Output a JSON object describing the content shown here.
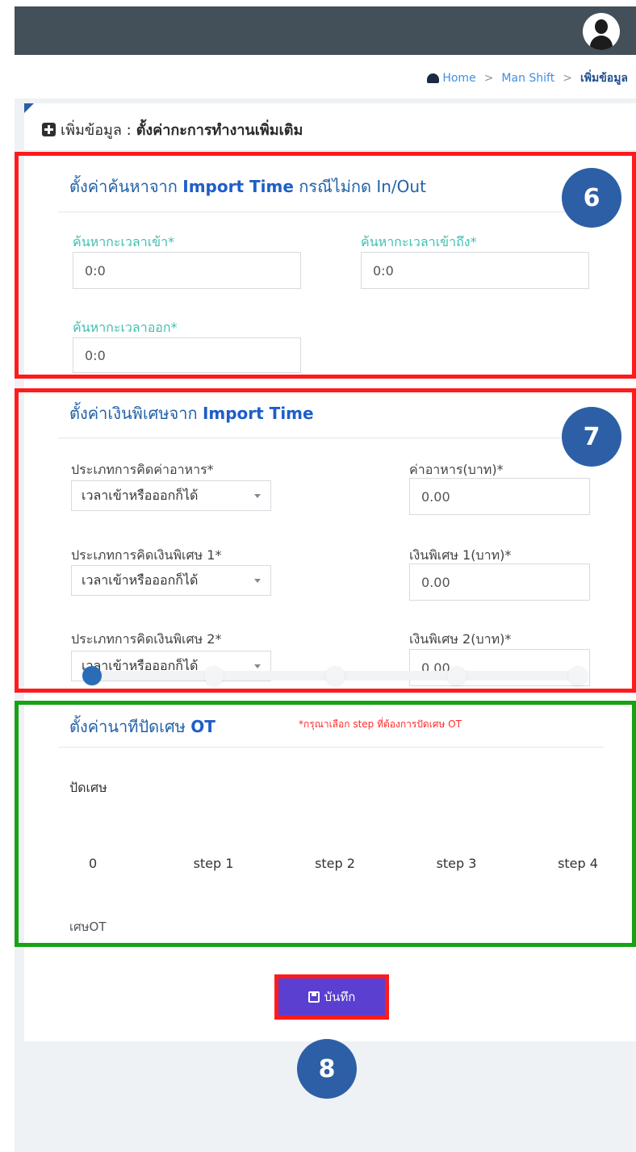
{
  "breadcrumb": {
    "home": "Home",
    "sep": ">",
    "section": "Man Shift",
    "current": "เพิ่มข้อมูล"
  },
  "page": {
    "title_prefix": "เพิ่มข้อมูล :",
    "title_main": "ตั้งค่ากะการทำงานเพิ่มเติม"
  },
  "section_search": {
    "title_prefix": "ตั้งค่าค้นหาจาก",
    "title_bold": "Import Time",
    "title_suffix": "กรณีไม่กด In/Out",
    "badge": "6",
    "fields": [
      {
        "label": "ค้นหากะเวลาเข้า*",
        "value": "0:0"
      },
      {
        "label": "ค้นหากะเวลาเข้าถึง*",
        "value": "0:0"
      },
      {
        "label": "ค้นหากะเวลาออก*",
        "value": "0:0"
      }
    ]
  },
  "section_bonus": {
    "title_prefix": "ตั้งค่าเงินพิเศษจาก",
    "title_bold": "Import Time",
    "badge": "7",
    "rows": [
      {
        "type_label": "ประเภทการคิดค่าอาหาร*",
        "type_value": "เวลาเข้าหรือออกก็ได้",
        "amount_label": "ค่าอาหาร(บาท)*",
        "amount_value": "0.00"
      },
      {
        "type_label": "ประเภทการคิดเงินพิเศษ 1*",
        "type_value": "เวลาเข้าหรือออกก็ได้",
        "amount_label": "เงินพิเศษ 1(บาท)*",
        "amount_value": "0.00"
      },
      {
        "type_label": "ประเภทการคิดเงินพิเศษ 2*",
        "type_value": "เวลาเข้าหรือออกก็ได้",
        "amount_label": "เงินพิเศษ 2(บาท)*",
        "amount_value": "0.00"
      }
    ]
  },
  "section_ot": {
    "title_prefix": "ตั้งค่านาทีปัดเศษ",
    "title_bold": "OT",
    "note": "*กรุณาเลือก step ที่ต้องการปัดเศษ OT",
    "rounding_label": "ปัดเศษ",
    "selected_step": 0,
    "steps": [
      "0",
      "step 1",
      "step 2",
      "step 3",
      "step 4"
    ],
    "footer_label": "เศษOT"
  },
  "actions": {
    "save_label": "บันทึก",
    "badge": "8"
  },
  "colors": {
    "topbar": "#434f59",
    "accent_blue": "#2d5fa6",
    "save_button": "#5b3fd0",
    "highlight_red": "#ff1b1b",
    "highlight_green": "#17a214",
    "label_teal": "#3fc0b2"
  }
}
